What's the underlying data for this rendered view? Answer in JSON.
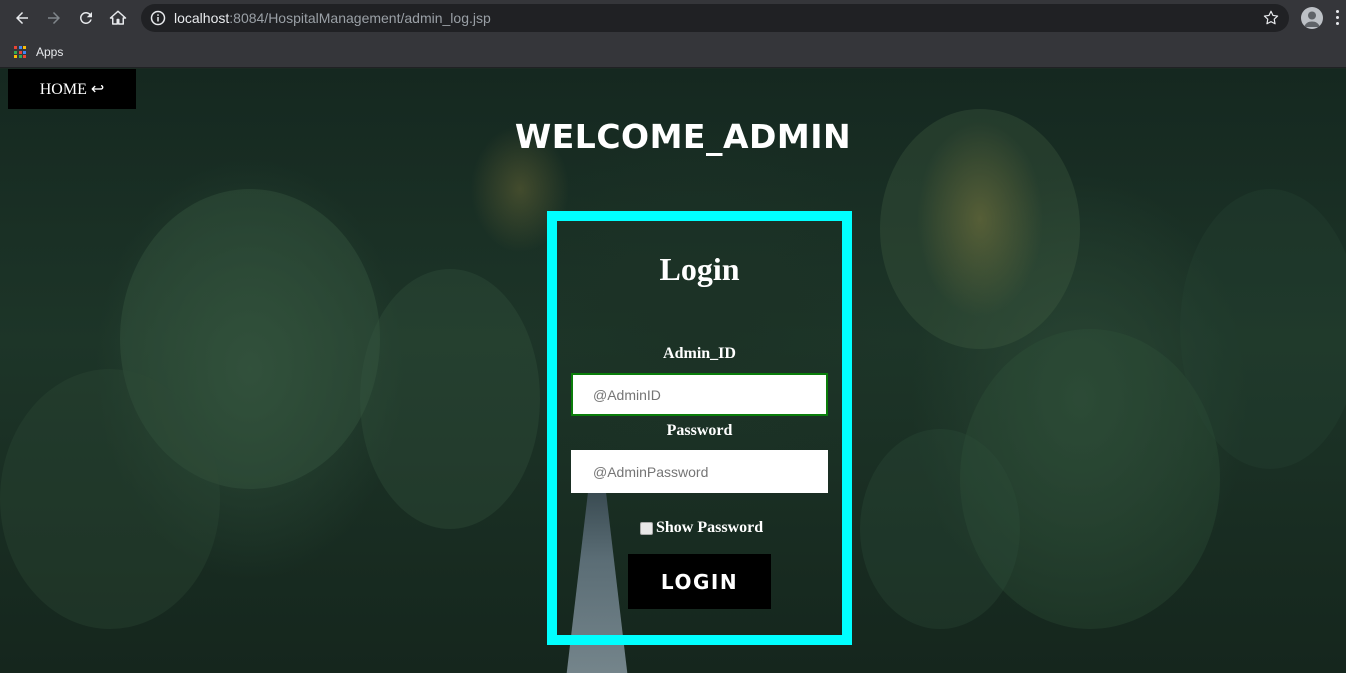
{
  "browser": {
    "url_host": "localhost",
    "url_rest": ":8084/HospitalManagement/admin_log.jsp",
    "bookmarks": [
      {
        "label": "Apps"
      }
    ]
  },
  "page": {
    "home_label": "HOME ↩",
    "title": "WELCOME_ADMIN"
  },
  "login": {
    "heading": "Login",
    "admin_id_label": "Admin_ID",
    "admin_id_placeholder": "@AdminID",
    "password_label": "Password",
    "password_placeholder": "@AdminPassword",
    "show_password_label": "Show Password",
    "submit_label": "LOGIN",
    "accent_color": "#00ffff"
  }
}
